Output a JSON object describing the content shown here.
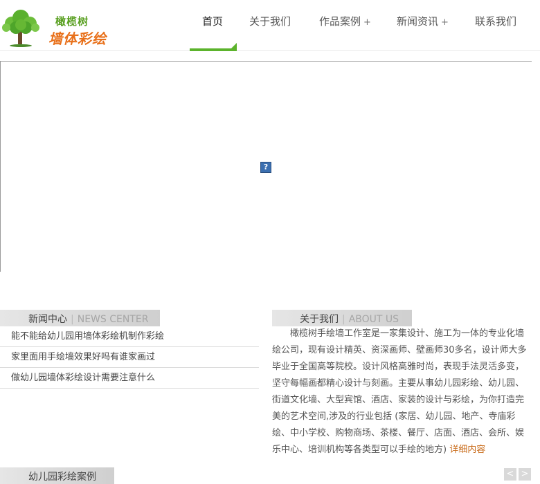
{
  "logo": {
    "title": "橄榄树",
    "subtitle": "墙体彩绘",
    "tree_icon": "tree-icon"
  },
  "nav": {
    "items": [
      {
        "label": "首页",
        "plus": ""
      },
      {
        "label": "关于我们",
        "plus": ""
      },
      {
        "label": "作品案例",
        "plus": "+"
      },
      {
        "label": "新闻资讯",
        "plus": "+"
      },
      {
        "label": "联系我们",
        "plus": ""
      }
    ],
    "active_color": "#5cb32c"
  },
  "banner": {
    "plugin_icon": "?"
  },
  "news": {
    "title_cn": "新闻中心",
    "separator": "|",
    "title_en": "NEWS CENTER",
    "items": [
      "能不能给幼儿园用墙体彩绘机制作彩绘",
      "家里面用手绘墙效果好吗有谁家画过",
      "做幼儿园墙体彩绘设计需要注意什么"
    ]
  },
  "about": {
    "title_cn": "关于我们",
    "separator": "|",
    "title_en": "ABOUT US",
    "body": "橄榄树手绘墙工作室是一家集设计、施工为一体的专业化墙绘公司，现有设计精英、资深画师、壁画师30多名，设计师大多毕业于全国高等院校。设计风格高雅时尚，表现手法灵活多变，坚守每幅画都精心设计与刻画。主要从事幼儿园彩绘、幼儿园、街道文化墙、大型宾馆、酒店、家装的设计与彩绘，为你打造完美的艺术空间,涉及的行业包括 (家居、幼儿园、地产、寺庙彩绘、中小学校、购物商场、茶楼、餐厅、店面、酒店、会所、娱乐中心、培训机构等各类型可以手绘的地方)",
    "more": "详细内容"
  },
  "cases": {
    "title": "幼儿园彩绘案例",
    "prev": "<",
    "next": ">"
  },
  "colors": {
    "accent_green": "#5cb32c",
    "accent_orange": "#e8701a",
    "more_link": "#c86a18"
  }
}
